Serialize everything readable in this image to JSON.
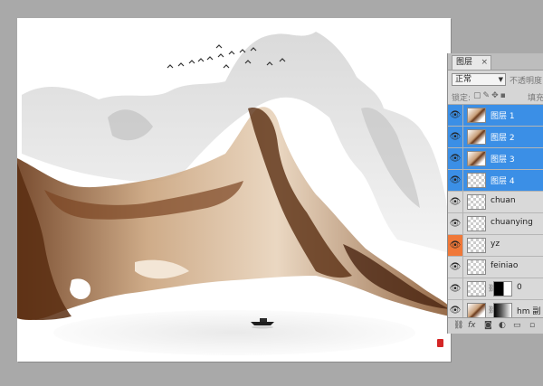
{
  "panel": {
    "tab_label": "图层",
    "tab_close": "×",
    "blend_mode": "正常",
    "opacity_label": "不透明度",
    "lock_label": "锁定:",
    "fill_label": "填充"
  },
  "layers": [
    {
      "name": "图层 1",
      "selected": true
    },
    {
      "name": "图层 2",
      "selected": true
    },
    {
      "name": "图层 3",
      "selected": true
    },
    {
      "name": "图层 4",
      "selected": true
    },
    {
      "name": "chuan",
      "selected": false
    },
    {
      "name": "chuanying",
      "selected": false
    },
    {
      "name": "yz",
      "selected": false
    },
    {
      "name": "feiniao",
      "selected": false
    },
    {
      "name": "0",
      "selected": false
    },
    {
      "name": "hm 副",
      "selected": false
    }
  ],
  "colors": {
    "selected_row": "#3b8fe6",
    "eye_highlight": "#f07838",
    "workspace": "#a9a9a9",
    "ink_dark": "#5a2e12",
    "ink_light": "#d9bf9f"
  },
  "icons": {
    "visibility": "eye-icon",
    "link": "link-icon",
    "fx": "fx-icon",
    "mask": "mask-icon",
    "adjustment": "adjustment-icon",
    "folder": "folder-icon",
    "new_layer": "new-layer-icon"
  }
}
